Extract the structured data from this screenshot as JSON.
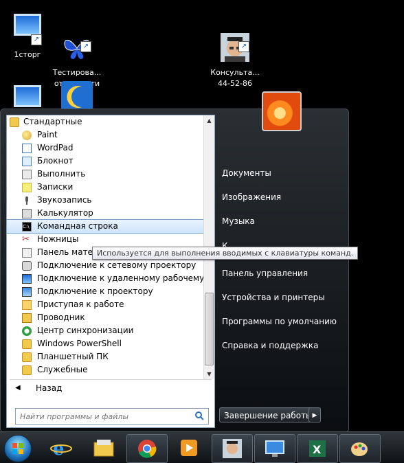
{
  "desktop_icons": [
    {
      "name": "1сторг",
      "icon": "remote-desktop-monitor-icon"
    },
    {
      "name": "Тестирова...\nотчетности",
      "icon": "butterfly-icon"
    },
    {
      "name": "Консульта...\n44-52-86",
      "icon": "consultant-icon"
    },
    {
      "name": "",
      "icon": "remote-desktop-monitor-icon"
    },
    {
      "name": "",
      "icon": "moon-icon"
    }
  ],
  "programs": {
    "header": "Стандартные",
    "items": [
      {
        "label": "Paint",
        "icon": "paint-icon"
      },
      {
        "label": "WordPad",
        "icon": "wordpad-icon"
      },
      {
        "label": "Блокнот",
        "icon": "notepad-icon"
      },
      {
        "label": "Выполнить",
        "icon": "run-icon"
      },
      {
        "label": "Записки",
        "icon": "sticky-notes-icon"
      },
      {
        "label": "Звукозапись",
        "icon": "microphone-icon"
      },
      {
        "label": "Калькулятор",
        "icon": "calculator-icon"
      },
      {
        "label": "Командная строка",
        "icon": "cmd-icon",
        "selected": true
      },
      {
        "label": "Ножницы",
        "icon": "scissors-icon"
      },
      {
        "label": "Панель матем",
        "icon": "math-panel-icon"
      },
      {
        "label": "Подключение к сетевому проектору",
        "icon": "network-projector-icon"
      },
      {
        "label": "Подключение к удаленному рабочему сто",
        "icon": "remote-desktop-icon"
      },
      {
        "label": "Подключение к проектору",
        "icon": "projector-icon"
      },
      {
        "label": "Приступая к работе",
        "icon": "getting-started-icon"
      },
      {
        "label": "Проводник",
        "icon": "explorer-icon"
      },
      {
        "label": "Центр синхронизации",
        "icon": "sync-center-icon"
      },
      {
        "label": "Windows PowerShell",
        "icon": "folder-icon"
      },
      {
        "label": "Планшетный ПК",
        "icon": "folder-icon"
      },
      {
        "label": "Служебные",
        "icon": "folder-icon"
      }
    ],
    "back_label": "Назад"
  },
  "search": {
    "placeholder": "Найти программы и файлы"
  },
  "tooltip": "Используется для выполнения вводимых с клавиатуры команд.",
  "right_items": [
    "Документы",
    "Изображения",
    "Музыка",
    "К",
    "Панель управления",
    "Устройства и принтеры",
    "Программы по умолчанию",
    "Справка и поддержка"
  ],
  "shutdown_label": "Завершение работы",
  "taskbar": {
    "items": [
      {
        "icon": "internet-explorer-icon"
      },
      {
        "icon": "file-explorer-icon"
      },
      {
        "icon": "chrome-icon"
      },
      {
        "icon": "media-player-icon"
      },
      {
        "icon": "consultant-icon"
      },
      {
        "icon": "remote-desktop-icon"
      },
      {
        "icon": "excel-icon"
      },
      {
        "icon": "paint-icon"
      }
    ]
  },
  "colors": {
    "desktop": "#000000",
    "start_menu_dark": "#1a1f23",
    "selection": "#cfe4fb",
    "accent_blue": "#1b6fb8"
  }
}
